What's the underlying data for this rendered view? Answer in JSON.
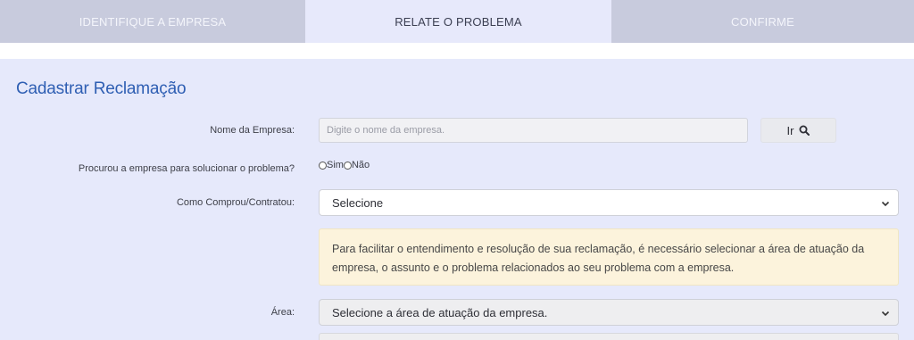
{
  "steps": [
    {
      "label": "IDENTIFIQUE A EMPRESA"
    },
    {
      "label": "RELATE O PROBLEMA"
    },
    {
      "label": "CONFIRME"
    }
  ],
  "form": {
    "title": "Cadastrar Reclamação",
    "empresa": {
      "label": "Nome da Empresa:",
      "placeholder": "Digite o nome da empresa.",
      "value": "",
      "button_label": "Ir"
    },
    "procurou": {
      "label": "Procurou a empresa para solucionar o problema?",
      "options": [
        "Sim",
        "Não"
      ]
    },
    "como": {
      "label": "Como Comprou/Contratou:",
      "selected": "Selecione"
    },
    "notice": "Para facilitar o entendimento e resolução de sua reclamação, é necessário selecionar a área de atuação da empresa, o assunto e o problema relacionados ao seu problema com a empresa.",
    "area": {
      "label": "Área:",
      "selected": "Selecione a área de atuação da empresa."
    }
  },
  "icons": {
    "ir_button": "search-icon",
    "select_arrow": "chevron-down-icon"
  },
  "colors": {
    "accent": "#2f5fb3",
    "active_step": "#e7e9fb",
    "inactive_step": "#c8cbdd",
    "notice_bg": "#fcf3dc"
  }
}
